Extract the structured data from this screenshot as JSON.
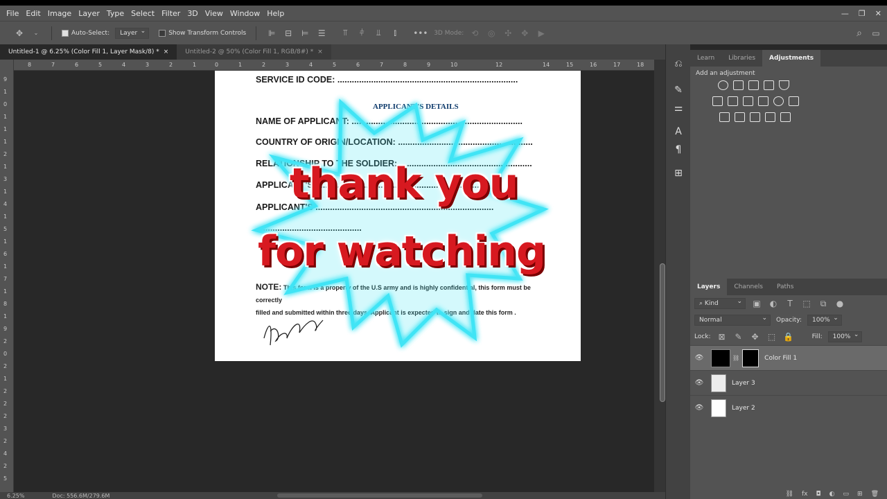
{
  "menu": [
    "File",
    "Edit",
    "Image",
    "Layer",
    "Type",
    "Select",
    "Filter",
    "3D",
    "View",
    "Window",
    "Help"
  ],
  "options": {
    "auto_select_label": "Auto-Select:",
    "auto_select_value": "Layer",
    "show_transform_label": "Show Transform Controls",
    "more_label": "•••",
    "mode_label": "3D Mode:"
  },
  "tabs": [
    {
      "label": "Untitled-1 @ 6.25% (Color Fill 1, Layer Mask/8) *",
      "close": "×"
    },
    {
      "label": "Untitled-2 @ 50% (Color Fill 1, RGB/8#) *",
      "close": "×"
    }
  ],
  "ruler_top": [
    "8",
    "7",
    "6",
    "5",
    "4",
    "3",
    "2",
    "1",
    "0",
    "1",
    "2",
    "3",
    "4",
    "5",
    "6",
    "7",
    "8",
    "9",
    "10",
    "12",
    "14",
    "15",
    "16",
    "17",
    "18"
  ],
  "ruler_left": [
    "9",
    "1",
    "0",
    "1",
    "1",
    "1",
    "2",
    "1",
    "3",
    "1",
    "4",
    "1",
    "5",
    "1",
    "6",
    "1",
    "7",
    "1",
    "8",
    "1",
    "9",
    "2",
    "0",
    "2",
    "1",
    "2",
    "2",
    "2",
    "3",
    "2",
    "4",
    "2",
    "5"
  ],
  "document": {
    "line_service": "SERVICE ID CODE: ...........................................................................",
    "heading": "APPLICANT'S DETAILS",
    "line_name": "NAME OF APPLICANT: .......................................................................",
    "line_country": "COUNTRY OF ORIGIN/LOCATION: ........................................................",
    "line_relation": "RELATIONSHIP TO THE SOLDIER: .......................................................",
    "line_applic1": "APPLICANT'S ..........................................................................",
    "line_applic2": "APPLICANT'S ..........................................................................",
    "line_dots": "............................................",
    "note_label": "NOTE:",
    "note_text1": "This form is a property of the U.S army and is highly confidential, this form must be correctly",
    "note_text2": "filled and submitted within three days. Applicant is expected to sign and date this form .",
    "overlay_line1": "thank you",
    "overlay_line2": "for watching"
  },
  "status": {
    "zoom": "6.25%",
    "doc": "Doc: 556.6M/279.6M"
  },
  "adjust_panel": {
    "tabs": [
      "Learn",
      "Libraries",
      "Adjustments"
    ],
    "active": "Adjustments",
    "title": "Add an adjustment"
  },
  "layers_panel": {
    "tabs": [
      "Layers",
      "Channels",
      "Paths"
    ],
    "active": "Layers",
    "filter": "Kind",
    "blend": "Normal",
    "opacity_label": "Opacity:",
    "opacity_value": "100%",
    "lock_label": "Lock:",
    "fill_label": "Fill:",
    "fill_value": "100%",
    "layers": [
      {
        "name": "Color Fill 1",
        "selected": true
      },
      {
        "name": "Layer 3",
        "selected": false
      },
      {
        "name": "Layer 2",
        "selected": false
      }
    ]
  },
  "colors": {
    "accent_glow": "#3fe4f5",
    "overlay_text": "#d71920"
  }
}
